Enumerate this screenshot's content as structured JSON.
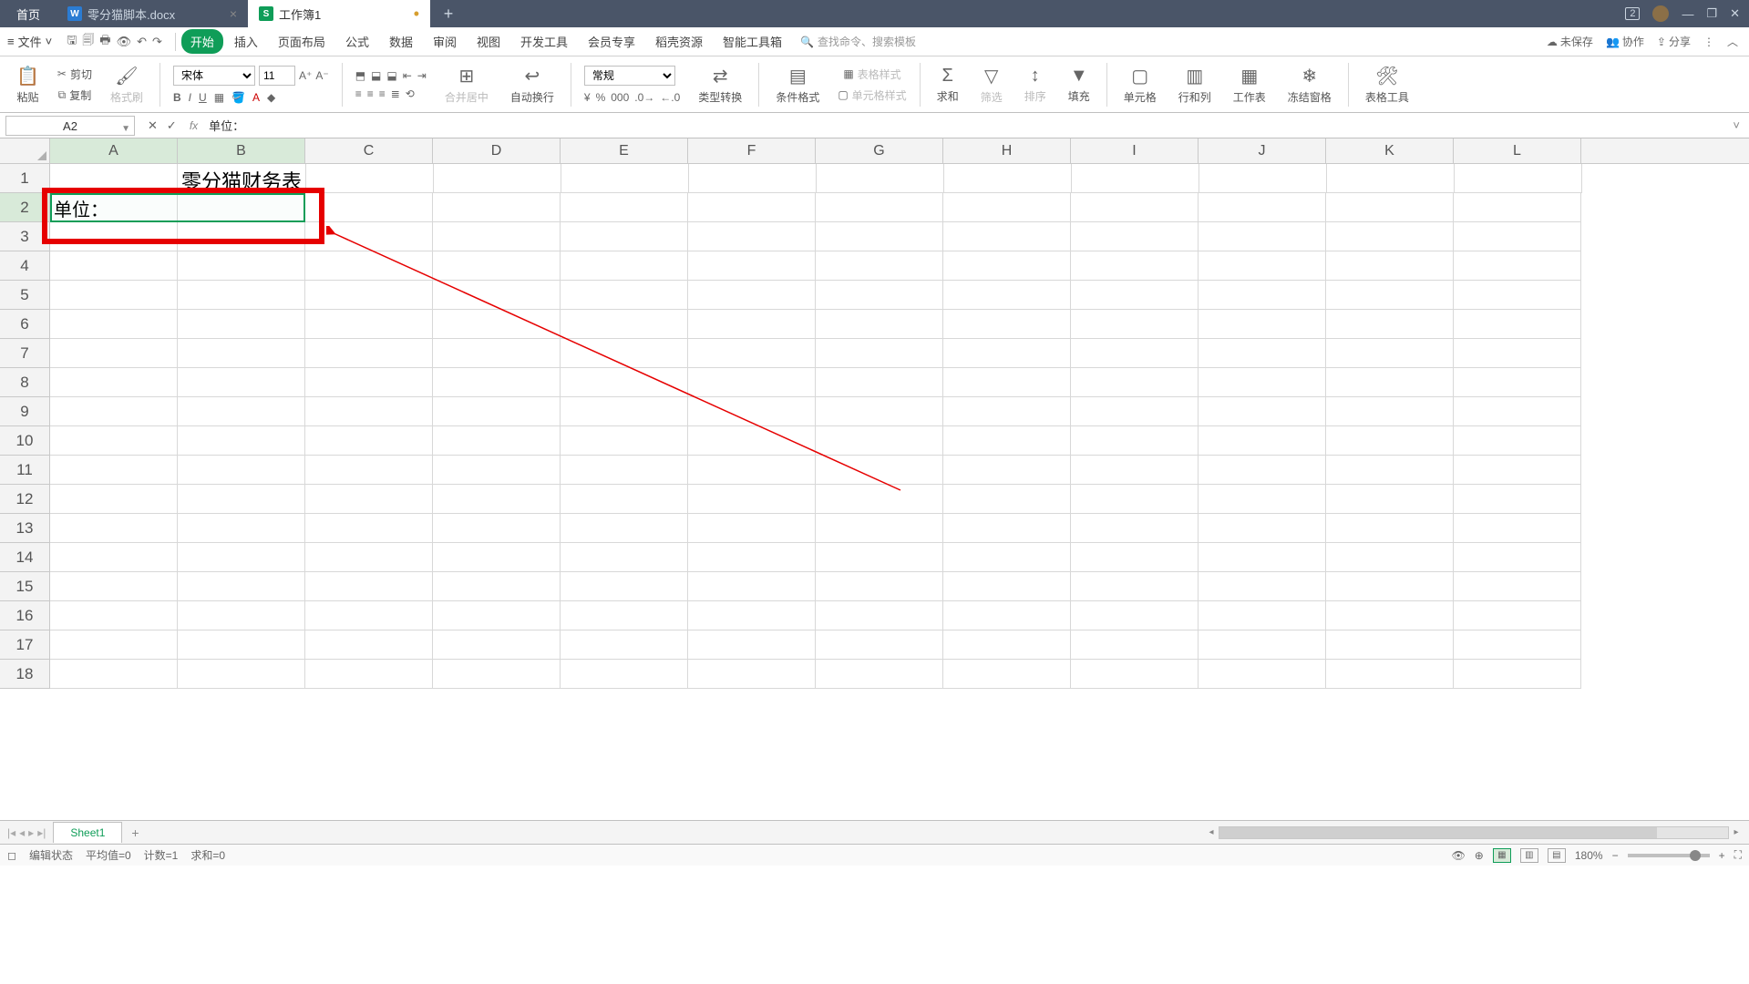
{
  "titlebar": {
    "home": "首页",
    "doc_tab": "零分猫脚本.docx",
    "sheet_tab": "工作簿1",
    "badge": "2"
  },
  "menu": {
    "file": "文件",
    "tabs": [
      "开始",
      "插入",
      "页面布局",
      "公式",
      "数据",
      "审阅",
      "视图",
      "开发工具",
      "会员专享",
      "稻壳资源",
      "智能工具箱"
    ],
    "search_ph": "查找命令、搜索模板",
    "unsaved": "未保存",
    "coop": "协作",
    "share": "分享"
  },
  "ribbon": {
    "paste": "粘贴",
    "cut": "剪切",
    "copy": "复制",
    "fmtpainter": "格式刷",
    "font": "宋体",
    "size": "11",
    "merge": "合并居中",
    "wrap": "自动换行",
    "numfmt": "常规",
    "typec": "类型转换",
    "condfmt": "条件格式",
    "tblstyle": "表格样式",
    "cellstyle": "单元格样式",
    "sum": "求和",
    "filter": "筛选",
    "sort": "排序",
    "fill": "填充",
    "cell": "单元格",
    "rowcol": "行和列",
    "worksheet": "工作表",
    "freeze": "冻结窗格",
    "tabletool": "表格工具"
  },
  "formula": {
    "namebox": "A2",
    "value": "单位："
  },
  "grid": {
    "cols": [
      "A",
      "B",
      "C",
      "D",
      "E",
      "F",
      "G",
      "H",
      "I",
      "J",
      "K",
      "L"
    ],
    "rows": [
      "1",
      "2",
      "3",
      "4",
      "5",
      "6",
      "7",
      "8",
      "9",
      "10",
      "11",
      "12",
      "13",
      "14",
      "15",
      "16",
      "17",
      "18"
    ],
    "title_cell": "零分猫财务表",
    "a2": "单位："
  },
  "sheets": {
    "s1": "Sheet1"
  },
  "status": {
    "mode": "编辑状态",
    "avg": "平均值=0",
    "count": "计数=1",
    "sum": "求和=0",
    "zoom": "180%"
  }
}
